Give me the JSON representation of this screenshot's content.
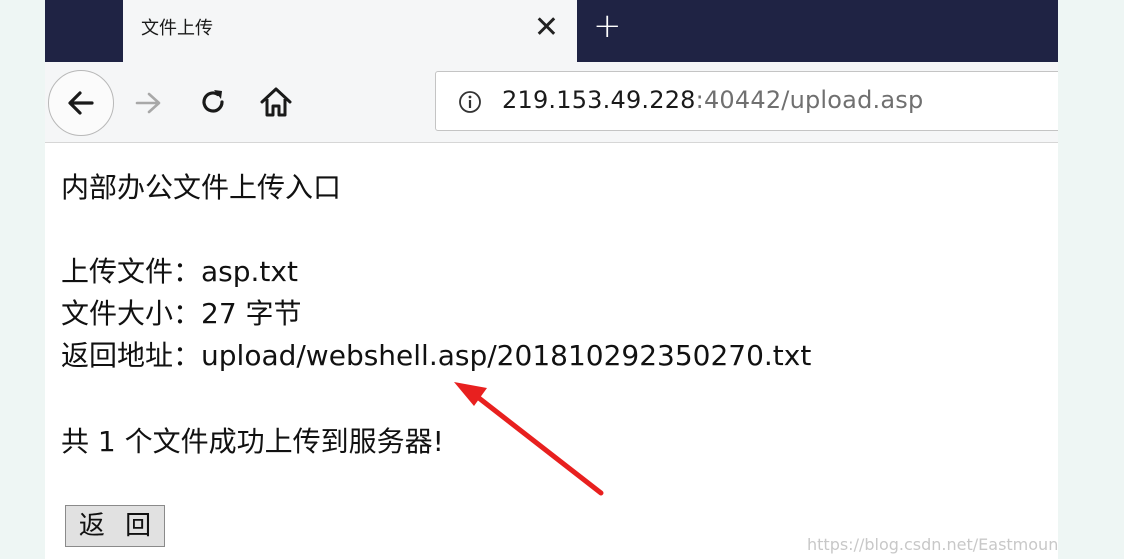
{
  "browser": {
    "tab": {
      "title": "文件上传",
      "close_glyph": "✕"
    },
    "new_tab_glyph": "+",
    "nav": {
      "back_icon": "arrow-left-icon",
      "forward_icon": "arrow-right-icon",
      "reload_icon": "reload-icon",
      "home_icon": "home-icon"
    },
    "address": {
      "info_icon": "info-icon",
      "host": "219.153.49.228",
      "rest": ":40442/upload.asp"
    }
  },
  "page": {
    "heading": "内部办公文件上传入口",
    "file_label": "上传文件：",
    "file_value": "asp.txt",
    "size_label": "文件大小：",
    "size_value": "27 字节",
    "path_label": "返回地址：",
    "path_value": "upload/webshell.asp/201810292350270.txt",
    "summary": "共 1 个文件成功上传到服务器!",
    "back_button": "返 回"
  },
  "annotation": {
    "arrow_color": "#e8201f"
  },
  "watermark": "https://blog.csdn.net/Eastmount"
}
